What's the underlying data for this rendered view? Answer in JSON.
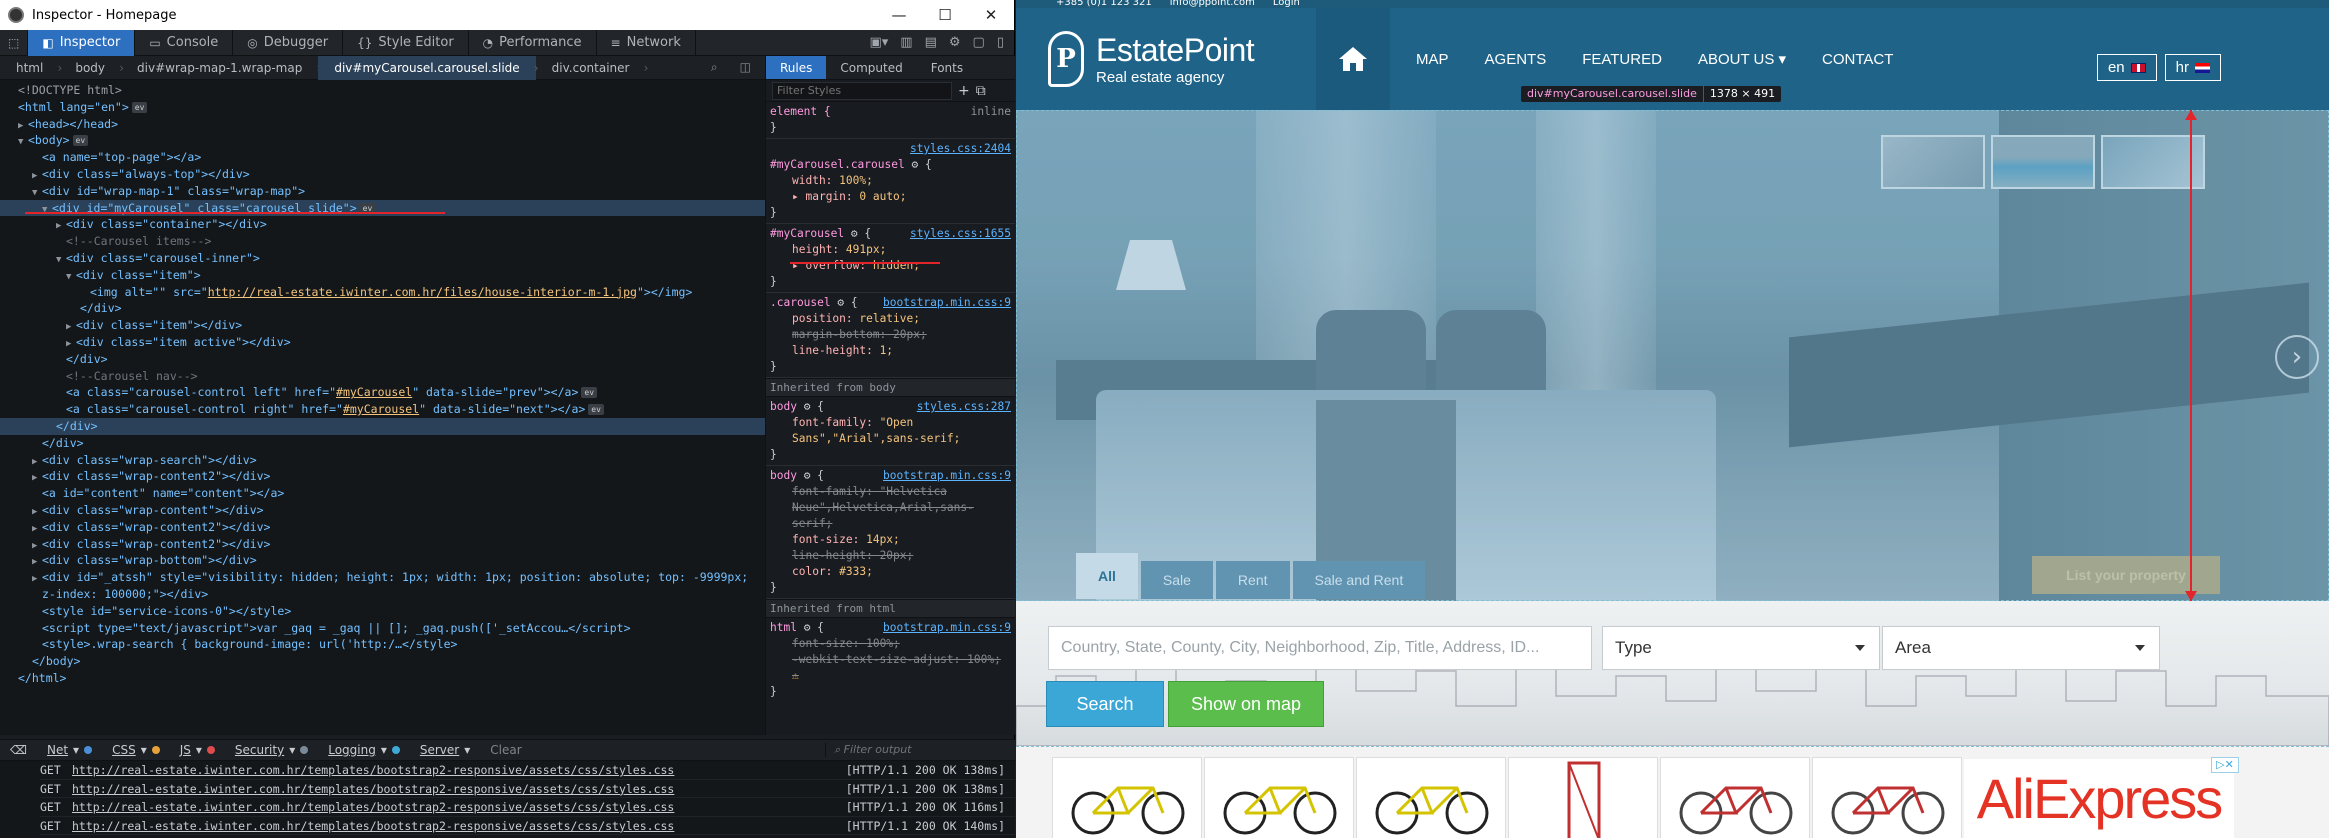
{
  "window": {
    "title": "Inspector - Homepage",
    "controls": [
      "—",
      "☐",
      "✕"
    ]
  },
  "toolbar": {
    "tabs": [
      {
        "label": "Inspector",
        "icon": "inspector-icon"
      },
      {
        "label": "Console",
        "icon": "console-icon"
      },
      {
        "label": "Debugger",
        "icon": "debugger-icon"
      },
      {
        "label": "Style Editor",
        "icon": "style-editor-icon"
      },
      {
        "label": "Performance",
        "icon": "performance-icon"
      },
      {
        "label": "Network",
        "icon": "network-icon"
      }
    ]
  },
  "breadcrumbs": [
    "html",
    "body",
    "div#wrap-map-1.wrap-map",
    "div#myCarousel.carousel.slide",
    "div.container"
  ],
  "markup": {
    "doctype": "<!DOCTYPE html>",
    "html_open": "<html lang=\"en\">",
    "head": "<head></head>",
    "body_open": "<body>",
    "a_top": "<a name=\"top-page\"></a>",
    "always_top": "<div class=\"always-top\"></div>",
    "wrap_map": "<div id=\"wrap-map-1\" class=\"wrap-map\">",
    "carousel": "<div id=\"myCarousel\" class=\"carousel slide\">",
    "container": "<div class=\"container\"></div>",
    "cmt_items": "<!--Carousel items-->",
    "inner": "<div class=\"carousel-inner\">",
    "item": "<div class=\"item\">",
    "img_pre": "<img alt=\"\" src=\"",
    "img_url": "http://real-estate.iwinter.com.hr/files/house-interior-m-1.jpg",
    "img_post": "\"></img>",
    "div_close": "</div>",
    "item2": "<div class=\"item\"></div>",
    "item_active": "<div class=\"item active\"></div>",
    "cmt_nav": "<!--Carousel nav-->",
    "ctrl_left_pre": "<a class=\"carousel-control left\" href=\"",
    "ctrl_href": "#myCarousel",
    "ctrl_left_post": "\" data-slide=\"prev\"></a>",
    "ctrl_right_pre": "<a class=\"carousel-control right\" href=\"",
    "ctrl_right_post": "\" data-slide=\"next\"></a>",
    "wrap_search": "<div class=\"wrap-search\"></div>",
    "wrap_content2": "<div class=\"wrap-content2\"></div>",
    "a_content": "<a id=\"content\" name=\"content\"></a>",
    "wrap_content": "<div class=\"wrap-content\"></div>",
    "wrap_bottom": "<div class=\"wrap-bottom\"></div>",
    "atssh": "<div id=\"_atssh\" style=\"visibility: hidden; height: 1px; width: 1px; position: absolute; top: -9999px;",
    "atssh2": "z-index: 100000;\"></div>",
    "style_svc": "<style id=\"service-icons-0\"></style>",
    "script_ga": "<script type=\"text/javascript\">var _gaq = _gaq || []; _gaq.push(['_setAccou…</script>",
    "style_wrap": "<style>.wrap-search { background-image: url('http:/…</style>",
    "body_close": "</body>",
    "html_close": "</html>",
    "badge": "ev"
  },
  "rules": {
    "tabs": [
      "Rules",
      "Computed",
      "Fonts"
    ],
    "filter_placeholder": "Filter Styles",
    "element": {
      "selector": "element {",
      "src": "inline",
      "close": "}"
    },
    "r1": {
      "selector": "#myCarousel.carousel",
      "src": "styles.css:2404",
      "p1": "width: ",
      "v1": "100%;",
      "p2": "margin: ",
      "v2": "0 auto;"
    },
    "r2": {
      "selector": "#myCarousel",
      "src": "styles.css:1655",
      "p1": "height: ",
      "v1": "491px;",
      "p2": "overflow: ",
      "v2": "hidden;"
    },
    "r3": {
      "selector": ".carousel",
      "src": "bootstrap.min.css:9",
      "p1": "position: ",
      "v1": "relative;",
      "p2": "margin-bottom: ",
      "v2": "20px;",
      "p3": "line-height: ",
      "v3": "1;"
    },
    "inh_body": "Inherited from body",
    "r4": {
      "selector": "body",
      "src": "styles.css:287",
      "p1": "font-family: ",
      "v1": "\"Open Sans\",\"Arial\",sans-serif;"
    },
    "r5": {
      "selector": "body",
      "src": "bootstrap.min.css:9",
      "p1": "font-family: ",
      "v1": "\"Helvetica Neue\",Helvetica,Arial,sans-serif;",
      "p2": "font-size: ",
      "v2": "14px;",
      "p3": "line-height: ",
      "v3": "20px;",
      "p4": "color: ",
      "v4": "#333;"
    },
    "inh_html": "Inherited from html",
    "r6": {
      "selector": "html",
      "src": "bootstrap.min.css:9",
      "p1": "font-size: ",
      "v1": "100%;",
      "p2": "-webkit-text-size-adjust: ",
      "v2": "100%;"
    },
    "brace_open": "{",
    "brace_close": "}"
  },
  "console": {
    "filters": [
      {
        "label": "Net",
        "color": "#4a90d9"
      },
      {
        "label": "CSS",
        "color": "#3aa8d8"
      },
      {
        "label": "JS",
        "color": "#e6a13a"
      },
      {
        "label": "Security",
        "color": "#e04b4b"
      },
      {
        "label": "Logging",
        "color": "#7a8a99"
      },
      {
        "label": "Server",
        "color": "#3fa9d6"
      }
    ],
    "clear": "Clear",
    "filter_placeholder": "Filter output",
    "lines": [
      {
        "method": "GET",
        "url": "http://real-estate.iwinter.com.hr/templates/bootstrap2-responsive/assets/css/styles.css",
        "status": "[HTTP/1.1 200 OK 138ms]"
      },
      {
        "method": "GET",
        "url": "http://real-estate.iwinter.com.hr/templates/bootstrap2-responsive/assets/css/styles.css",
        "status": "[HTTP/1.1 200 OK 138ms]"
      },
      {
        "method": "GET",
        "url": "http://real-estate.iwinter.com.hr/templates/bootstrap2-responsive/assets/css/styles.css",
        "status": "[HTTP/1.1 200 OK 116ms]"
      },
      {
        "method": "GET",
        "url": "http://real-estate.iwinter.com.hr/templates/bootstrap2-responsive/assets/css/styles.css",
        "status": "[HTTP/1.1 200 OK 140ms]"
      }
    ]
  },
  "site": {
    "topstrip": {
      "phone": "+385 (0)1 123 321",
      "email": "info@ppoint.com",
      "login": "Login"
    },
    "brand": "EstatePoint",
    "tagline": "Real estate agency",
    "menu": [
      "MAP",
      "AGENTS",
      "FEATURED",
      "ABOUT US ▾",
      "CONTACT"
    ],
    "langs": [
      {
        "code": "en",
        "flag": "uk"
      },
      {
        "code": "hr",
        "flag": "hr"
      }
    ],
    "tooltip": {
      "name": "div#myCarousel.carousel.slide",
      "dims": "1378 × 491"
    },
    "hero_tabs": [
      "All",
      "Sale",
      "Rent",
      "Sale and Rent"
    ],
    "list_property": "List your property",
    "search_placeholder": "Country, State, County, City, Neighborhood, Zip, Title, Address, ID...",
    "type_select": "Type",
    "area_select": "Area",
    "search_button": "Search",
    "map_button": "Show on map",
    "ad_brand": "AliExpress",
    "ad_close": "▷✕",
    "colors": {
      "nav": "#1f6488",
      "search_btn": "#3ba7d6",
      "map_btn": "#5bbd4c",
      "accent_red": "#e3242b"
    }
  }
}
